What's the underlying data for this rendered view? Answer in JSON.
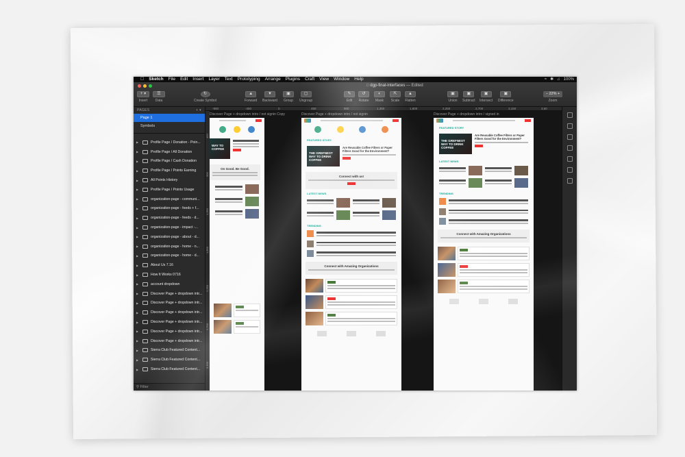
{
  "menubar": {
    "app": "Sketch",
    "items": [
      "File",
      "Edit",
      "Insert",
      "Layer",
      "Text",
      "Prototyping",
      "Arrange",
      "Plugins",
      "Craft",
      "View",
      "Window",
      "Help"
    ],
    "battery": "100%"
  },
  "window": {
    "doc_name": "dgp-final-interfaces",
    "doc_status": "— Edited"
  },
  "toolbar": {
    "insert": "Insert",
    "data": "Data",
    "create_symbol": "Create Symbol",
    "forward": "Forward",
    "backward": "Backward",
    "group": "Group",
    "ungroup": "Ungroup",
    "edit": "Edit",
    "rotate": "Rotate",
    "mask": "Mask",
    "scale": "Scale",
    "flatten": "Flatten",
    "union": "Union",
    "subtract": "Subtract",
    "intersect": "Intersect",
    "difference": "Difference",
    "zoom_label": "Zoom",
    "zoom_value": "22%"
  },
  "ruler": {
    "ticks": [
      "-900",
      "-450",
      "0",
      "450",
      "900",
      "1,350",
      "1,800",
      "2,250",
      "2,700",
      "3,150",
      "3,60"
    ],
    "vticks": [
      "450",
      "900",
      "1,350",
      "1,800",
      "2,250",
      "2,700",
      "3,150"
    ]
  },
  "sidebar": {
    "pages_header": "PAGES",
    "pages": [
      "Page 1",
      "Symbols"
    ],
    "layers": [
      "Profile Page / Donation - Poin...",
      "Profile Page / All Donation",
      "Profile Page / Cash Donation",
      "Profile Page / Points Earning",
      "All Points History",
      "Profile Page / Points Usage",
      "organization-page - communi...",
      "organization-page - feeds + f...",
      "organization-page - feeds - d...",
      "organization-page - impact -...",
      "organization-page - about - d...",
      "organization-page - home - n...",
      "organization-page - home - d...",
      "About Us 7.16",
      "How It Works 0716",
      "account dropdown",
      "Discover Page + dropdown intr...",
      "Discover Page + dropdown intr...",
      "Discover Page + dropdown intr...",
      "Discover Page + dropdown intr...",
      "Discover Page + dropdown intr...",
      "Discover Page + dropdown intr...",
      "Sierra Club Featured Content...",
      "Sierra Club Featured Content...",
      "Sierra Club Featured Content..."
    ],
    "filter": "Filter"
  },
  "canvas": {
    "artboards": [
      {
        "label": "Discover Page + dropdown intro / not signin Copy"
      },
      {
        "label": "Discover Page + dropdown intro / not signin"
      },
      {
        "label": "Discover Page + dropdown intro / signed in"
      }
    ],
    "hero_text": "THE GREFNEST WAY TO DRINK COFFEE",
    "hero_text_3": "THE GREFNEST WAY TO DRINK COFFEE",
    "hero_text_1": "WAY TO COFFEE",
    "hero_title": "Are Reusable Coffee Filters or Paper Filters Good for the Environment?",
    "connect": "Connect with us!",
    "on_good": "On Good. Be Good.",
    "section_latest": "LATEST NEWS",
    "section_trending": "TRENDING",
    "section_featured": "FEATURED STORY",
    "orgs_title": "Connect with Amazing Organizations",
    "colors": {
      "accent_red": "#e33333",
      "accent_teal": "#11aa99",
      "selection_blue": "#1f6fe0"
    }
  }
}
